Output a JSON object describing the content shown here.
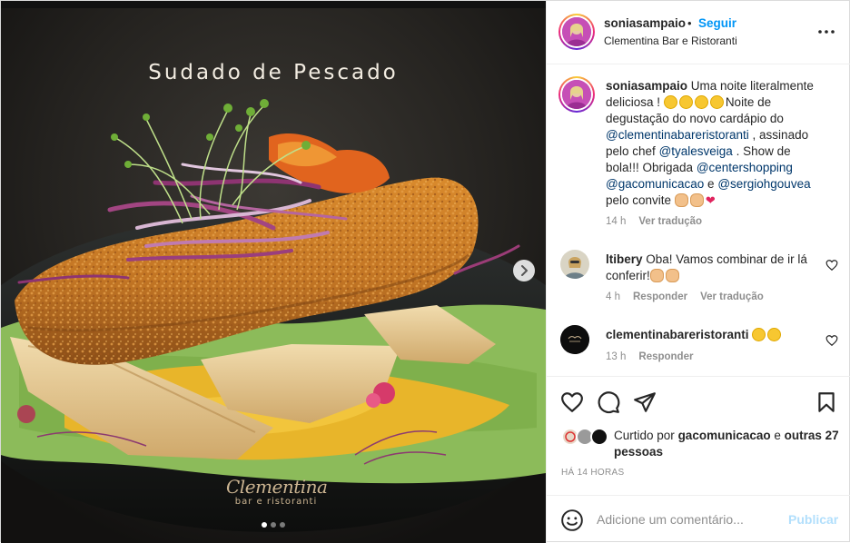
{
  "post": {
    "image_title": "Sudado de Pescado",
    "brand_script": "Clementina",
    "brand_sub": "bar e ristoranti",
    "carousel": {
      "slide_count": 3,
      "active_index": 0
    }
  },
  "header": {
    "username": "soniasampaio",
    "separator": "•",
    "follow_label": "Seguir",
    "location": "Clementina Bar e Ristoranti"
  },
  "caption": {
    "username": "soniasampaio",
    "p1": "Uma noite literalmente deliciosa !",
    "p2": "Noite de degustação do novo cardápio do",
    "m1": "@clementinabareristoranti",
    "p3": ", assinado pelo chef",
    "m2": "@tyalesveiga",
    "p4": ". Show de bola!!! Obrigada",
    "m3": "@centershopping",
    "m4": "@gacomunicacao",
    "p5": "e",
    "m5": "@sergiohgouvea",
    "p6": "pelo convite",
    "time": "14 h",
    "translate": "Ver tradução"
  },
  "comments": [
    {
      "username": "ltibery",
      "text": "Oba! Vamos combinar de ir lá conferir!",
      "time": "4 h",
      "reply": "Responder",
      "translate": "Ver tradução"
    },
    {
      "username": "clementinabareristoranti",
      "text": "",
      "time": "13 h",
      "reply": "Responder"
    }
  ],
  "likes": {
    "prefix": "Curtido por",
    "user": "gacomunicacao",
    "conj": "e",
    "others": "outras 27 pessoas"
  },
  "timestamp": "HÁ 14 HORAS",
  "composer": {
    "placeholder": "Adicione um comentário...",
    "publish_label": "Publicar"
  },
  "colors": {
    "link": "#0095f6",
    "mention": "#00376b",
    "muted": "#8e8e8e",
    "publish_disabled": "#b2dffc"
  }
}
